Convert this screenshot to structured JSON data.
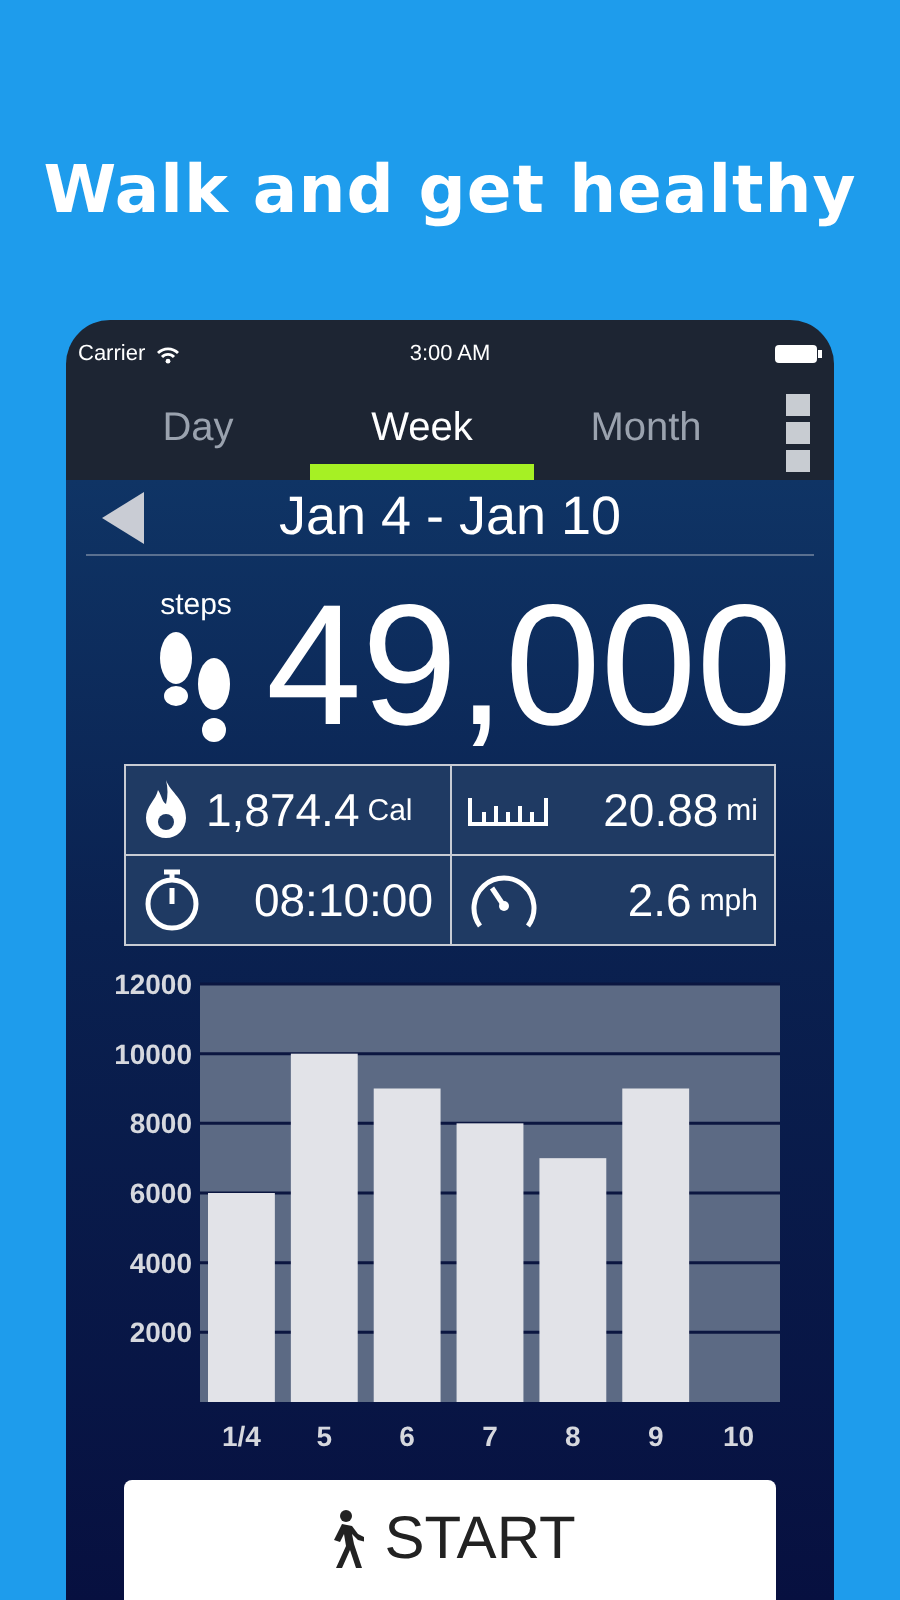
{
  "headline": "Walk and get healthy",
  "status_bar": {
    "carrier": "Carrier",
    "time": "3:00 AM"
  },
  "tabs": [
    {
      "label": "Day",
      "selected": false
    },
    {
      "label": "Week",
      "selected": true
    },
    {
      "label": "Month",
      "selected": false
    }
  ],
  "date_range": "Jan 4 - Jan 10",
  "steps": {
    "label": "steps",
    "value": "49,000"
  },
  "stats": [
    {
      "kind": "calories",
      "value": "1,874.4",
      "unit": "Cal"
    },
    {
      "kind": "distance",
      "value": "20.88",
      "unit": "mi"
    },
    {
      "kind": "time",
      "value": "08:10:00"
    },
    {
      "kind": "speed",
      "value": "2.6",
      "unit": "mph"
    }
  ],
  "chart_data": {
    "type": "bar",
    "categories": [
      "1/4",
      "5",
      "6",
      "7",
      "8",
      "9",
      "10"
    ],
    "values": [
      6000,
      10000,
      9000,
      8000,
      7000,
      9000,
      null
    ],
    "ylim": [
      0,
      12000
    ],
    "grid": true,
    "yticks": [
      2000,
      4000,
      6000,
      8000,
      10000,
      12000
    ]
  },
  "start_button": "START"
}
